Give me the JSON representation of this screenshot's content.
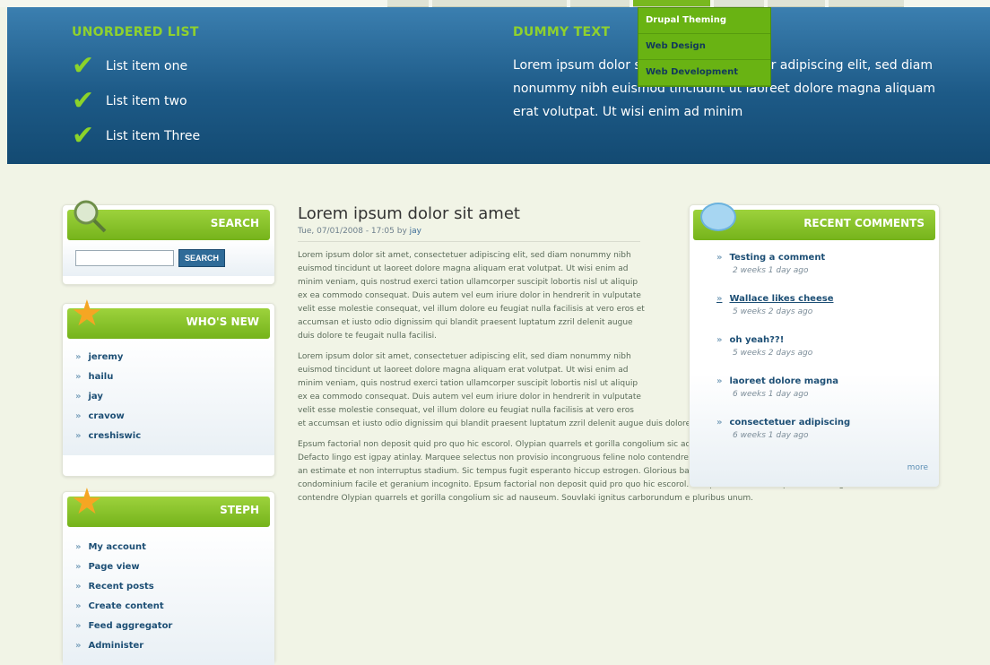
{
  "top_nav": {
    "tab_count": 9,
    "active_index": 3
  },
  "hero": {
    "list_heading": "UNORDERED LIST",
    "list_items": [
      "List item one",
      "List item two",
      "List item Three"
    ],
    "text_heading": "DUMMY TEXT",
    "text": "Lorem ipsum dolor sit amet, consectetuer adipiscing elit, sed diam nonummy nibh euismod tincidunt ut laoreet dolore magna aliquam erat volutpat. Ut wisi enim ad minim"
  },
  "dropdown": {
    "items": [
      "Drupal Theming",
      "Web Design",
      "Web Development"
    ]
  },
  "search": {
    "title": "SEARCH",
    "input_value": "",
    "button": "SEARCH"
  },
  "whos_new": {
    "title": "WHO'S NEW",
    "users": [
      "jeremy",
      "hailu",
      "jay",
      "cravow",
      "creshiswic"
    ]
  },
  "steph": {
    "title": "STEPH",
    "links": [
      "My account",
      "Page view",
      "Recent posts",
      "Create content",
      "Feed aggregator",
      "Administer"
    ]
  },
  "node": {
    "title": "Lorem ipsum dolor sit amet",
    "date": "Tue, 07/01/2008 - 17:05 by",
    "author": "jay",
    "paragraph1": "Lorem ipsum dolor sit amet, consectetuer adipiscing elit, sed diam nonummy nibh euismod tincidunt ut laoreet dolore magna aliquam erat volutpat. Ut wisi enim ad minim veniam, quis nostrud exerci tation ullamcorper suscipit lobortis nisl ut aliquip ex ea commodo consequat. Duis autem vel eum iriure dolor in hendrerit in vulputate velit esse molestie consequat, vel illum dolore eu feugiat nulla facilisis at vero eros et accumsan et iusto odio dignissim qui blandit praesent luptatum zzril delenit augue duis dolore te feugait nulla facilisi.",
    "paragraph2_narrow": "Lorem ipsum dolor sit amet, consectetuer adipiscing elit, sed diam nonummy nibh euismod tincidunt ut laoreet dolore magna aliquam erat volutpat. Ut wisi enim ad minim veniam, quis nostrud exerci tation ullamcorper suscipit lobortis nisl ut aliquip ex ea commodo consequat. Duis autem vel eum iriure dolor in hendrerit in vulputate velit esse molestie consequat, vel illum dolore eu feugiat nulla facilisis at vero eros",
    "paragraph2_wide": "et accumsan et iusto odio dignissim qui blandit praesent luptatum zzril delenit augue duis dolore te feugait nulla facilisi.",
    "paragraph3": "Epsum factorial non deposit quid pro quo hic escorol. Olypian quarrels et gorilla congolium sic ad nauseum. Souvlaki ignitus carborundum e pluribus unum. Defacto lingo est igpay atinlay. Marquee selectus non provisio incongruous feline nolo contendre. Gratuitous octopus niacin, sodium glutimate. Quote meon an estimate et non interruptus stadium. Sic tempus fugit esperanto hiccup estrogen. Glorious baklava ex librus hup hey ad infinitum. Non sequitur condominium facile et geranium incognito. Epsum factorial non deposit quid pro quo hic escorol. Marquee selectus non provisio incongruous feline nolo contendre Olypian quarrels et gorilla congolium sic ad nauseum. Souvlaki ignitus carborundum e pluribus unum."
  },
  "recent_comments": {
    "title": "RECENT COMMENTS",
    "items": [
      {
        "title": "Testing a comment",
        "ago": "2 weeks 1 day ago"
      },
      {
        "title": "Wallace likes cheese",
        "ago": "5 weeks 2 days ago"
      },
      {
        "title": "oh yeah??!",
        "ago": "5 weeks 2 days ago"
      },
      {
        "title": "laoreet dolore magna",
        "ago": "6 weeks 1 day ago"
      },
      {
        "title": "consectetuer adipiscing",
        "ago": "6 weeks 1 day ago"
      }
    ],
    "more": "more"
  }
}
